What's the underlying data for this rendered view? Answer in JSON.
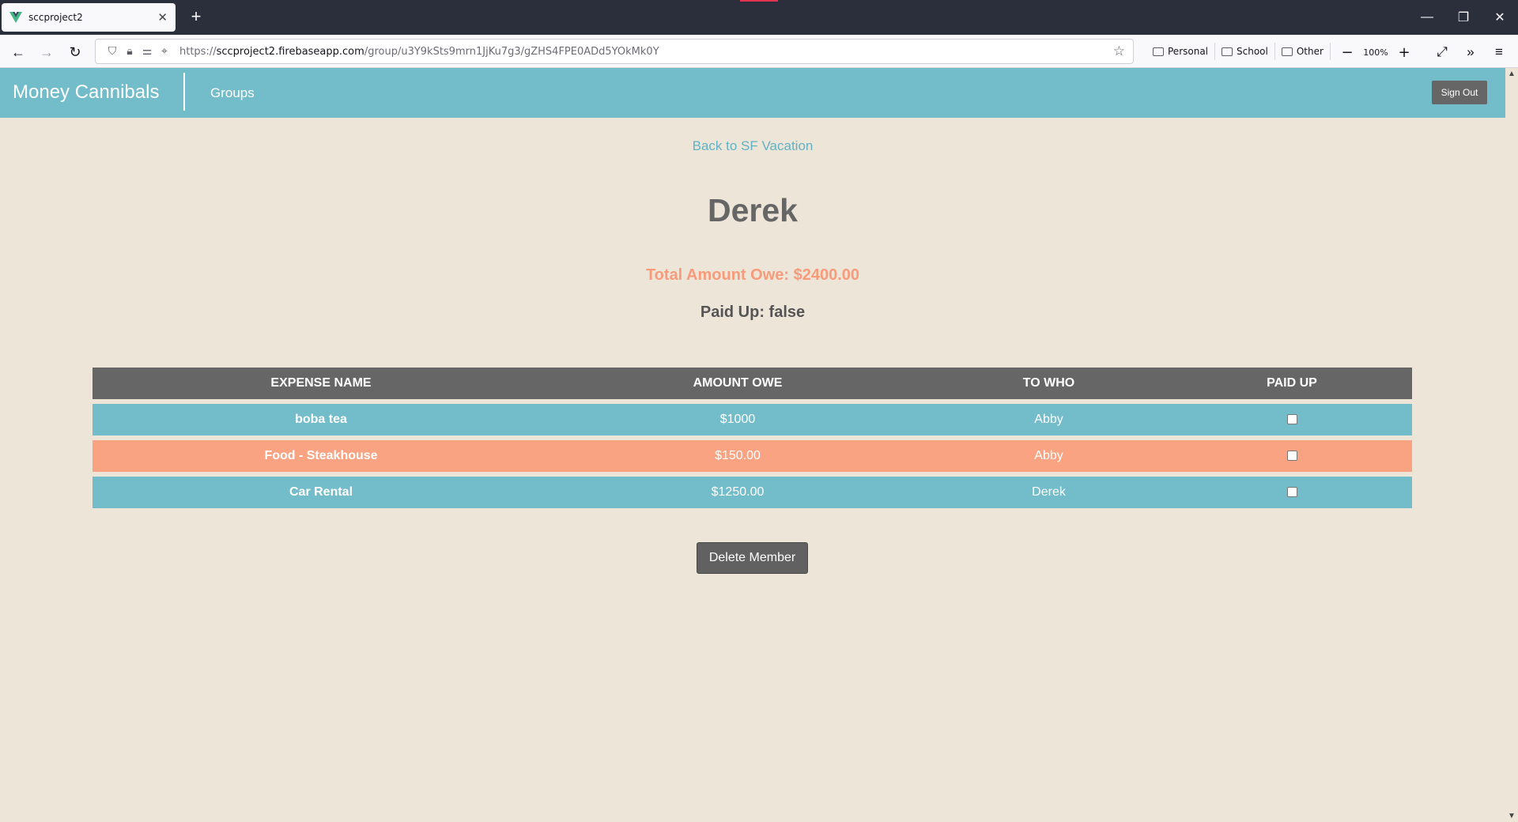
{
  "browser": {
    "tab_title": "sccproject2",
    "url_prefix": "https://",
    "url_host": "sccproject2.firebaseapp.com",
    "url_path": "/group/u3Y9kSts9mrn1JjKu7g3/gZHS4FPE0ADd5YOkMk0Y",
    "bookmarks": [
      "Personal",
      "School",
      "Other"
    ],
    "zoom": "100%"
  },
  "header": {
    "brand": "Money Cannibals",
    "nav_groups": "Groups",
    "sign_out": "Sign Out"
  },
  "main": {
    "back_link": "Back to SF Vacation",
    "member_name": "Derek",
    "total_owe": "Total Amount Owe: $2400.00",
    "paid_up": "Paid Up: false",
    "table": {
      "columns": [
        "EXPENSE NAME",
        "AMOUNT OWE",
        "TO WHO",
        "PAID UP"
      ],
      "rows": [
        {
          "name": "boba tea",
          "amount": "$1000",
          "to_who": "Abby",
          "paid": false
        },
        {
          "name": "Food - Steakhouse",
          "amount": "$150.00",
          "to_who": "Abby",
          "paid": false
        },
        {
          "name": "Car Rental",
          "amount": "$1250.00",
          "to_who": "Derek",
          "paid": false
        }
      ]
    },
    "delete_button": "Delete Member"
  },
  "colors": {
    "header_bg": "#73bcc9",
    "page_bg": "#ede5d8",
    "row_blue": "#73bcc9",
    "row_peach": "#f9a383",
    "accent_owe": "#f79b7a",
    "dark_gray": "#666666"
  }
}
